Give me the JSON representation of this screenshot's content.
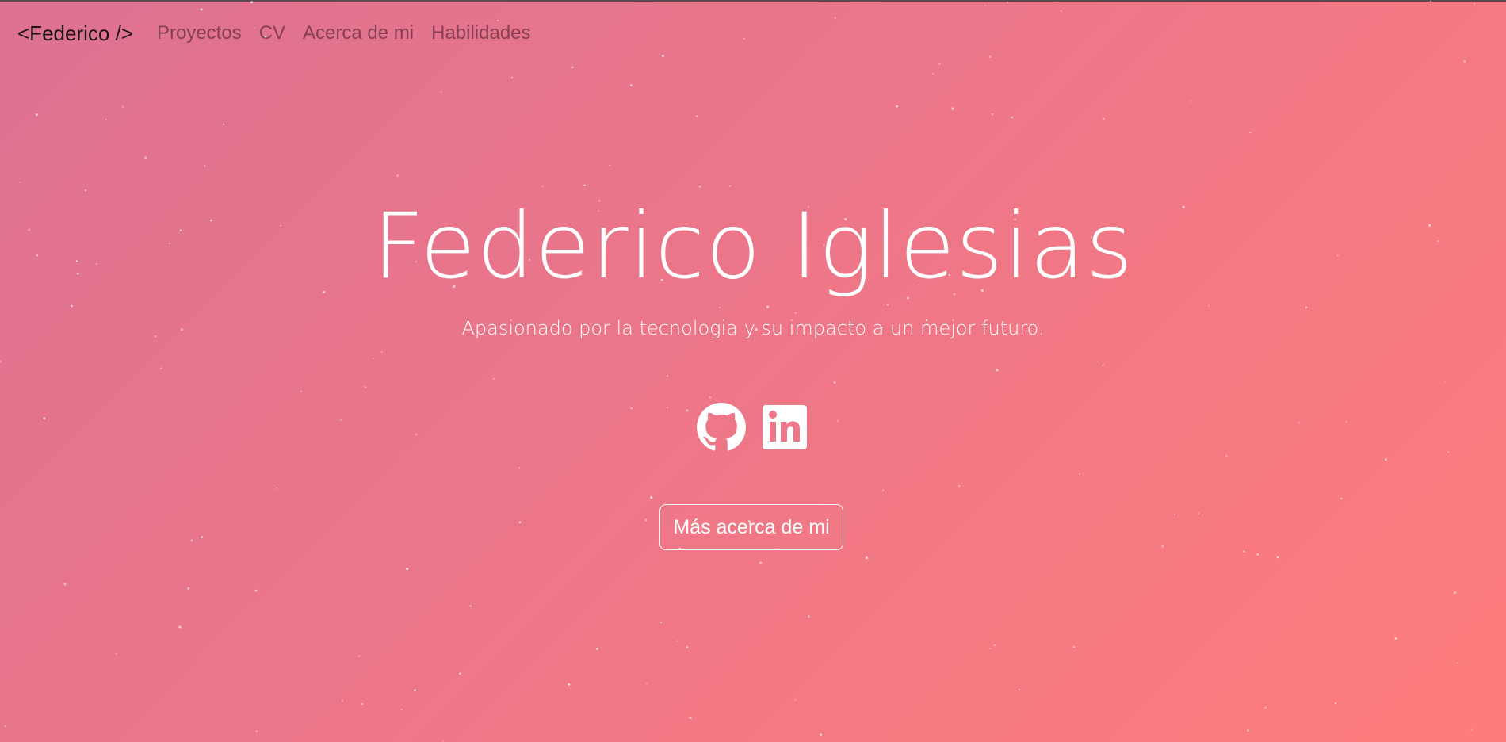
{
  "nav": {
    "brand": "<Federico />",
    "links": [
      "Proyectos",
      "CV",
      "Acerca de mi",
      "Habilidades"
    ]
  },
  "hero": {
    "title": "Federico Iglesias",
    "subtitle": "Apasionado por la tecnologia y su impacto a un mejor futuro.",
    "social": [
      "github-icon",
      "linkedin-icon"
    ],
    "cta_label": "Más acerca de mi"
  },
  "colors": {
    "gradient_start": "#dd7292",
    "gradient_end": "#fe7d7b",
    "text": "#ffffff"
  }
}
